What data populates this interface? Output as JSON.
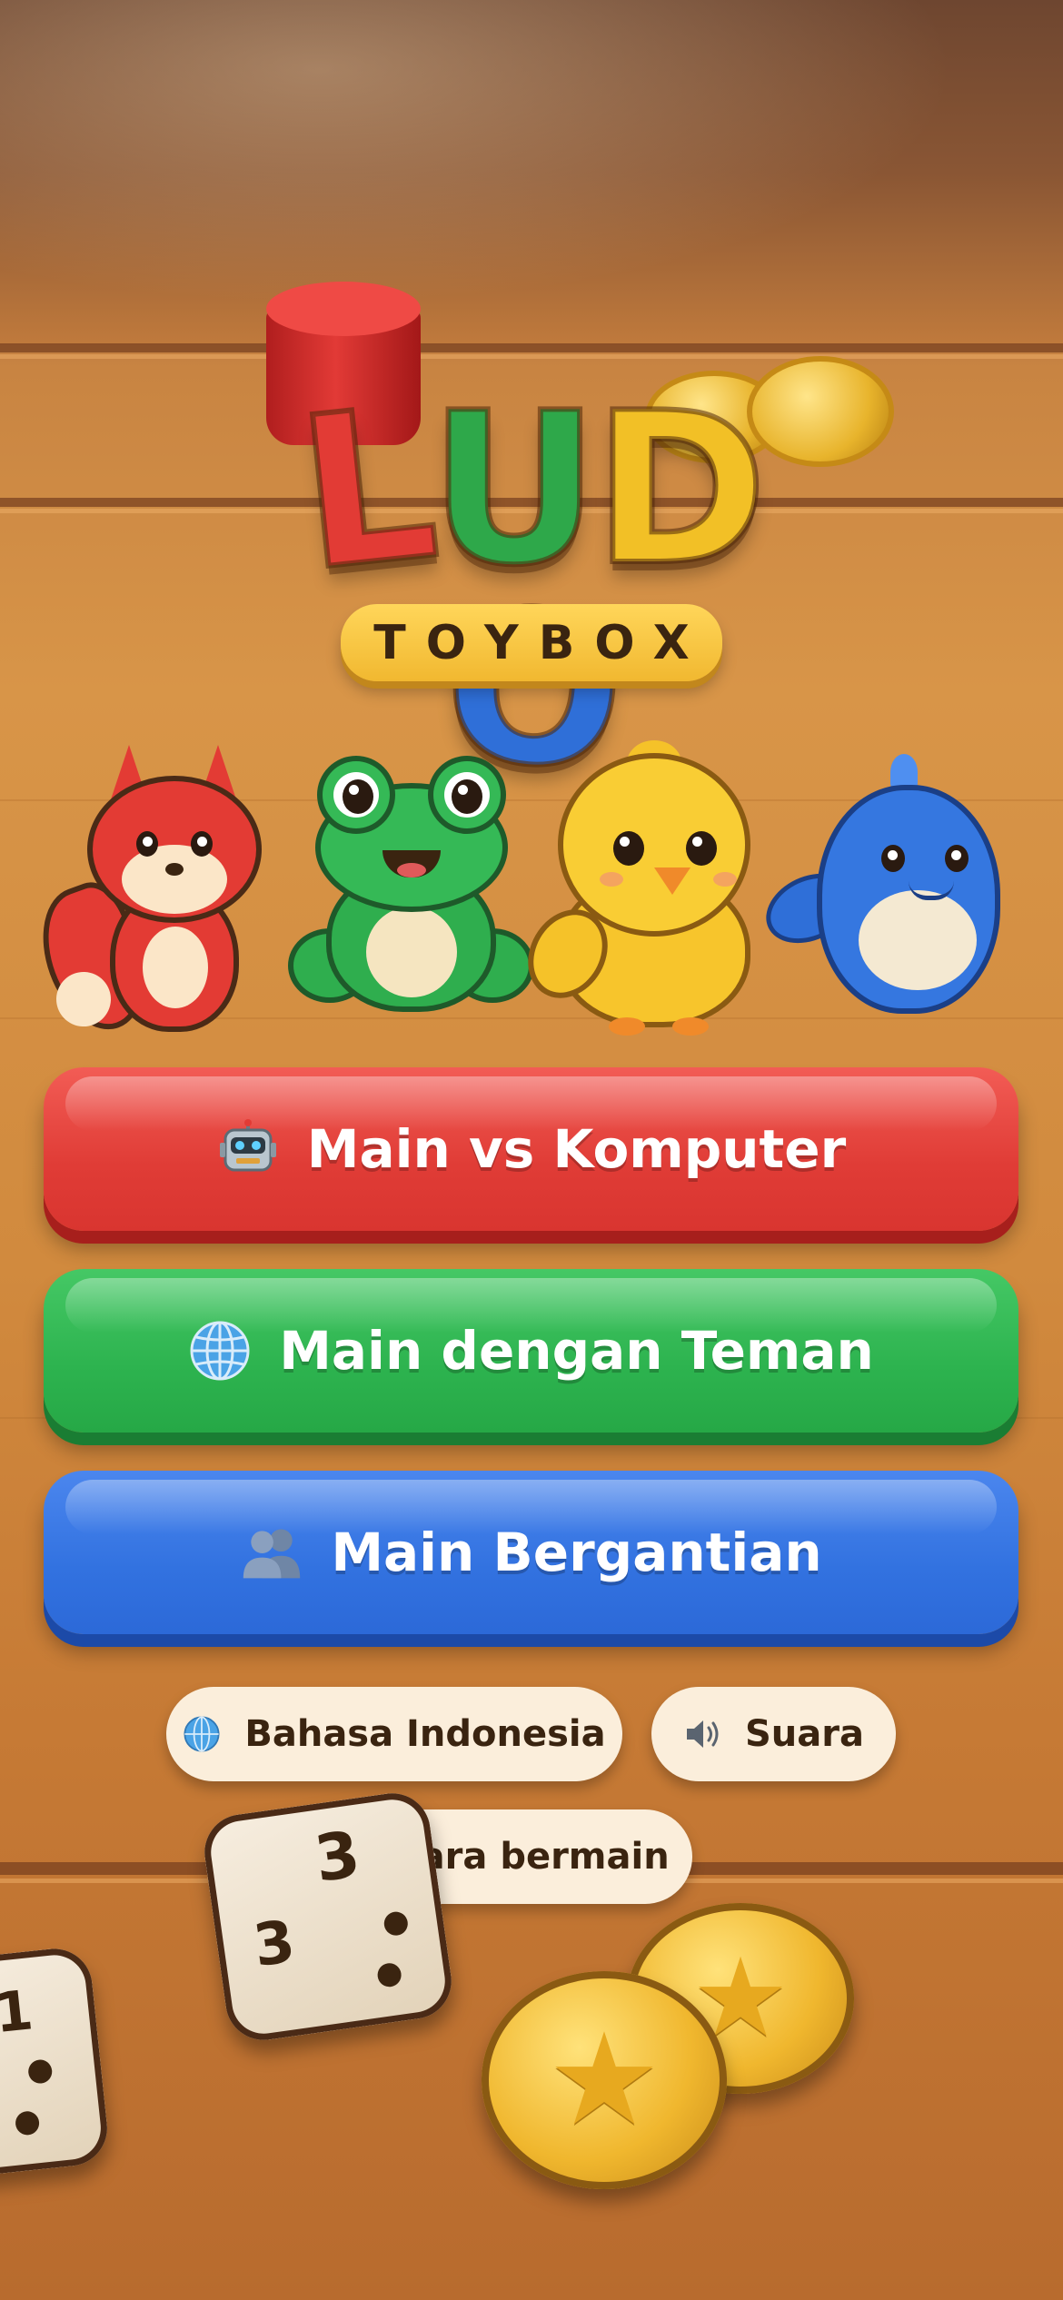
{
  "logo": {
    "letters": [
      "L",
      "U",
      "D",
      "O"
    ],
    "subtitle": "TOYBOX"
  },
  "mascots": [
    {
      "name": "fox",
      "color": "#e23b35"
    },
    {
      "name": "frog",
      "color": "#2ea84a"
    },
    {
      "name": "chick",
      "color": "#f2c026"
    },
    {
      "name": "whale",
      "color": "#2f6fd8"
    }
  ],
  "menu": {
    "vs_computer": {
      "label": "Main vs Komputer",
      "icon": "robot-icon",
      "color": "#e03c36"
    },
    "with_friends": {
      "label": "Main dengan Teman",
      "icon": "globe-icon",
      "color": "#2db34f"
    },
    "pass_and_play": {
      "label": "Main Bergantian",
      "icon": "people-icon",
      "color": "#3272e0"
    }
  },
  "options": {
    "language": {
      "label": "Bahasa Indonesia",
      "icon": "globe-icon"
    },
    "sound": {
      "label": "Suara",
      "icon": "speaker-icon"
    },
    "how_to_play": {
      "label": "Cara bermain"
    }
  },
  "decor": {
    "dice_numbers": [
      "3",
      "3",
      "1"
    ]
  }
}
